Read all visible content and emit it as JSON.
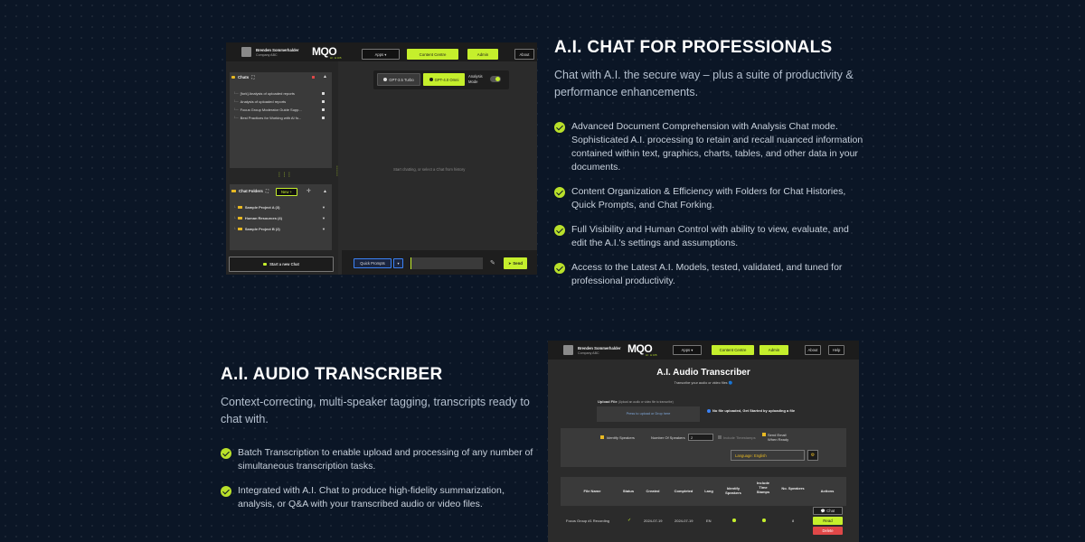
{
  "colors": {
    "background": "#0b1626",
    "accent": "#b9e02a",
    "app_lime": "#c5ef2c",
    "danger": "#e04848"
  },
  "chat_section": {
    "title": "A.I. CHAT FOR PROFESSIONALS",
    "subtitle": "Chat with A.I. the secure way – plus a suite of productivity & performance enhancements.",
    "features": [
      "Advanced Document Comprehension with Analysis Chat mode. Sophisticated A.I. processing to retain and recall nuanced information contained within text, graphics, charts, tables, and other data in your documents.",
      "Content Organization & Efficiency with Folders for Chat Histories, Quick Prompts, and Chat Forking.",
      "Full Visibility and Human Control with ability to view, evaluate, and edit the A.I.'s settings and assumptions.",
      "Access to the Latest A.I. Models, tested, validated, and tuned for professional productivity."
    ],
    "check_icon": "check-circle-icon"
  },
  "audio_section": {
    "title": "A.I. AUDIO TRANSCRIBER",
    "subtitle": "Context-correcting, multi-speaker tagging, transcripts ready to chat with.",
    "features": [
      "Batch Transcription to enable upload and processing of any number of simultaneous transcription tasks.",
      "Integrated with A.I. Chat to produce high-fidelity summarization, analysis, or Q&A with your transcribed audio or video files."
    ]
  },
  "chat_app": {
    "user": {
      "name": "Brenden Sommerhalder",
      "company": "Company ABC"
    },
    "logo": {
      "text": "MQO",
      "sub": "AI HUB"
    },
    "nav": {
      "apps": "Apps ▾",
      "content_centre": "Content Centre",
      "admin": "Admin",
      "about": "About"
    },
    "models": {
      "gpt35": "GPT-3.5 Turbo",
      "gpt4": "GPT-4.0 Omni",
      "analysis_mode": "Analysis Mode"
    },
    "chats": {
      "header": "Chats",
      "items": [
        "[fork] Analysis of uploaded reports",
        "Analysis of uploaded reports",
        "Focus Group Moderator Guide Supp...",
        "Best Practices for Working with AI fo..."
      ]
    },
    "folders": {
      "header": "Chat Folders",
      "new_button": "New +",
      "items": [
        "Sample Project A (3)",
        "Human Resources (4)",
        "Sample Project B (2)"
      ]
    },
    "empty_state": "Start chatting, or select a Chat from history",
    "start_new_chat": "Start a new Chat",
    "quick_prompts": "Quick Prompts",
    "send": "Send"
  },
  "audio_app": {
    "user": {
      "name": "Brenden Sommerhalder",
      "company": "Company ABC"
    },
    "logo": {
      "text": "MQO",
      "sub": "AI HUB"
    },
    "nav": {
      "apps": "Apps ▾",
      "content_centre": "Content Centre",
      "admin": "Admin",
      "about": "About",
      "help": "Help"
    },
    "title": "A.I. Audio Transcriber",
    "subtitle": "Transcribe your audio or video files 🔵",
    "upload_label": "Upload File",
    "upload_hint": "(Upload an audio or video file to transcribe)",
    "upload_drop": "Press to upload or Drop here",
    "no_file": "No file uploaded, Get Started by uploading a file",
    "identify_speakers": "Identify Speakers",
    "num_speakers_label": "Number Of Speakers",
    "num_speakers_value": "2",
    "include_timestamps": "Include Timestamps",
    "send_email": "Send Email When Ready",
    "language": "Language: English",
    "table": {
      "headers": [
        "File Name",
        "Status",
        "Created",
        "Completed",
        "Lang",
        "Identify Speakers",
        "Include Time Stamps",
        "No. Speakers",
        "Actions"
      ],
      "row": {
        "file": "Focus Group #1 Recording",
        "status": "✓",
        "created": "2024-07-19",
        "completed": "2024-07-19",
        "lang": "EN",
        "speakers": "8"
      },
      "actions": {
        "chat": "💬 Chat",
        "read": "Read",
        "delete": "Delete"
      }
    }
  }
}
